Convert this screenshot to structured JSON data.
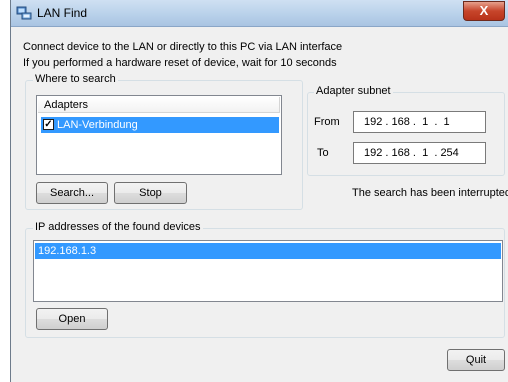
{
  "window": {
    "title": "LAN Find",
    "close_label": "X"
  },
  "intro": {
    "line1": "Connect device to the LAN or directly to this PC via LAN interface",
    "line2": "If you performed a hardware reset of device, wait for 10 seconds"
  },
  "where_to_search": {
    "label": "Where to search",
    "adapters_header": "Adapters",
    "adapters": [
      {
        "name": "LAN-Verbindung",
        "checked": true,
        "selected": true
      }
    ]
  },
  "adapter_subnet": {
    "label": "Adapter subnet",
    "from_label": "From",
    "from_value": "192 . 168 .  1  .  1",
    "to_label": "To",
    "to_value": "192 . 168 .  1  . 254"
  },
  "actions": {
    "search_label": "Search...",
    "stop_label": "Stop"
  },
  "status_text": "The search has been interrupted",
  "found_devices": {
    "label": "IP addresses of the found devices",
    "items": [
      "192.168.1.3"
    ],
    "open_label": "Open"
  },
  "quit_label": "Quit",
  "colors": {
    "selection": "#3399ff",
    "window_bg": "#f0f0f0"
  }
}
